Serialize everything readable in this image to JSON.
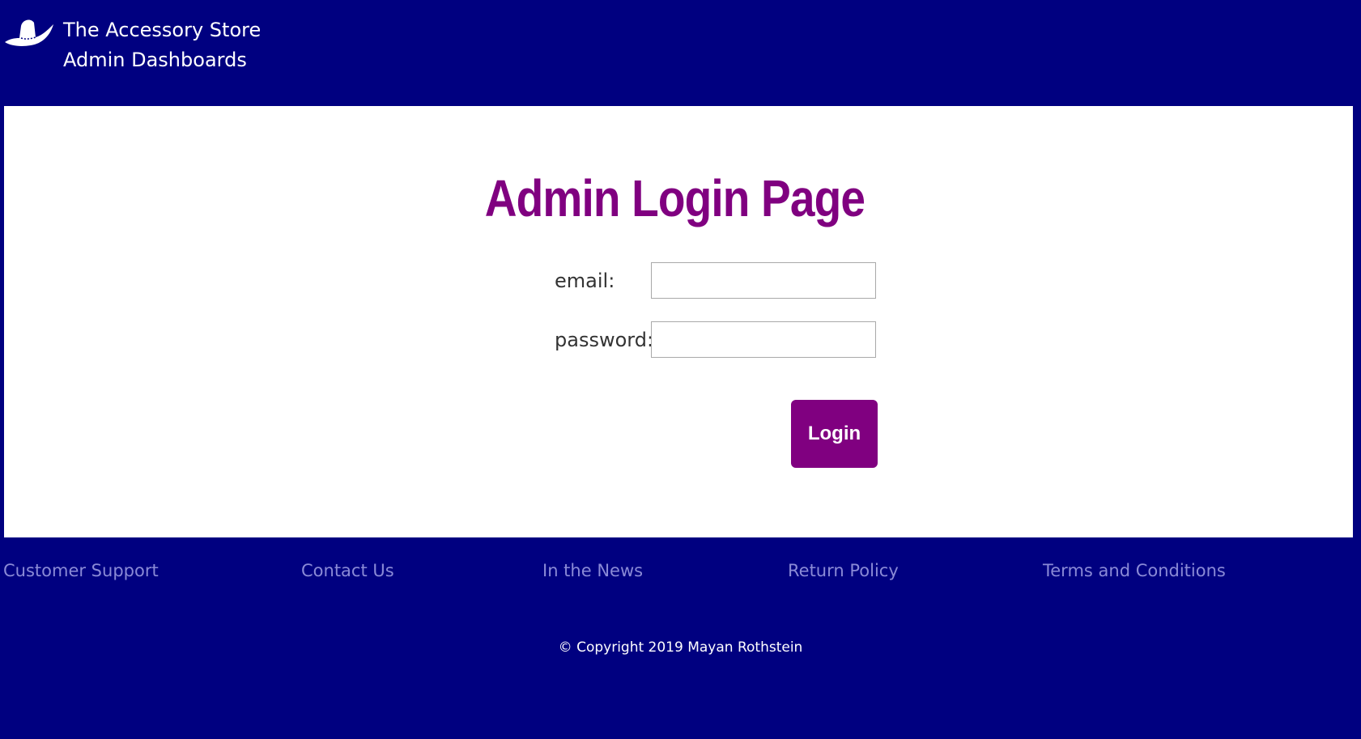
{
  "header": {
    "logo_icon": "cowboy-hat-icon",
    "store_name": "The Accessory Store",
    "section_name": "Admin Dashboards"
  },
  "login": {
    "title": "Admin Login Page",
    "email_label": "email:",
    "email_value": "",
    "password_label": "password:",
    "password_value": "",
    "submit_label": "Login"
  },
  "footer": {
    "links": [
      "Customer Support",
      "Contact Us",
      "In the News",
      "Return Policy",
      "Terms and Conditions"
    ],
    "copyright": "© Copyright 2019 Mayan Rothstein"
  },
  "colors": {
    "background": "#000080",
    "accent": "#800080",
    "footer_link": "#8a8ad6",
    "panel": "#ffffff"
  }
}
